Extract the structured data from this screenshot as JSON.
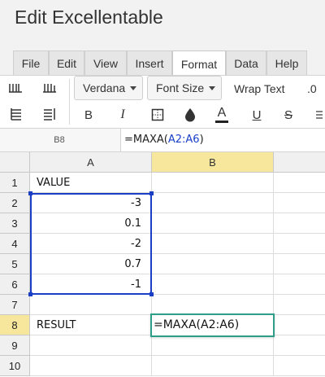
{
  "app": {
    "title": "Edit Excellentable"
  },
  "menu": {
    "tabs": [
      {
        "label": "File"
      },
      {
        "label": "Edit"
      },
      {
        "label": "View"
      },
      {
        "label": "Insert"
      },
      {
        "label": "Format",
        "active": true
      },
      {
        "label": "Data"
      },
      {
        "label": "Help"
      }
    ]
  },
  "toolbar": {
    "font_name": "Verdana",
    "font_size": "Font Size",
    "wrap_text": "Wrap Text",
    "decimal": ".0",
    "bold": "B",
    "italic": "I",
    "underline": "U",
    "strikethrough": "S",
    "font_color": "A",
    "icons": [
      "insert-row-above-icon",
      "insert-column-icon",
      "delete-row-icon",
      "delete-column-icon",
      "borders-icon",
      "fill-color-icon"
    ]
  },
  "formula_bar": {
    "cell_ref": "B8",
    "formula_prefix": "=MAXA(",
    "formula_range": "A2:A6",
    "formula_suffix": ")"
  },
  "sheet": {
    "columns": [
      "A",
      "B"
    ],
    "selected_column": "B",
    "selected_row": "8",
    "rows": [
      {
        "num": "1",
        "a": "VALUE",
        "b": ""
      },
      {
        "num": "2",
        "a": "-3",
        "b": ""
      },
      {
        "num": "3",
        "a": "0.1",
        "b": ""
      },
      {
        "num": "4",
        "a": "-2",
        "b": ""
      },
      {
        "num": "5",
        "a": "0.7",
        "b": ""
      },
      {
        "num": "6",
        "a": "-1",
        "b": ""
      },
      {
        "num": "7",
        "a": "",
        "b": ""
      },
      {
        "num": "8",
        "a": "RESULT",
        "b": ""
      },
      {
        "num": "9",
        "a": "",
        "b": ""
      },
      {
        "num": "10",
        "a": "",
        "b": ""
      }
    ],
    "editing_cell_value": "=MAXA(A2:A6)"
  },
  "colors": {
    "range_highlight": "#1b3fc4",
    "editor_border": "#2f9e88",
    "selected_header": "#f6e79d"
  }
}
